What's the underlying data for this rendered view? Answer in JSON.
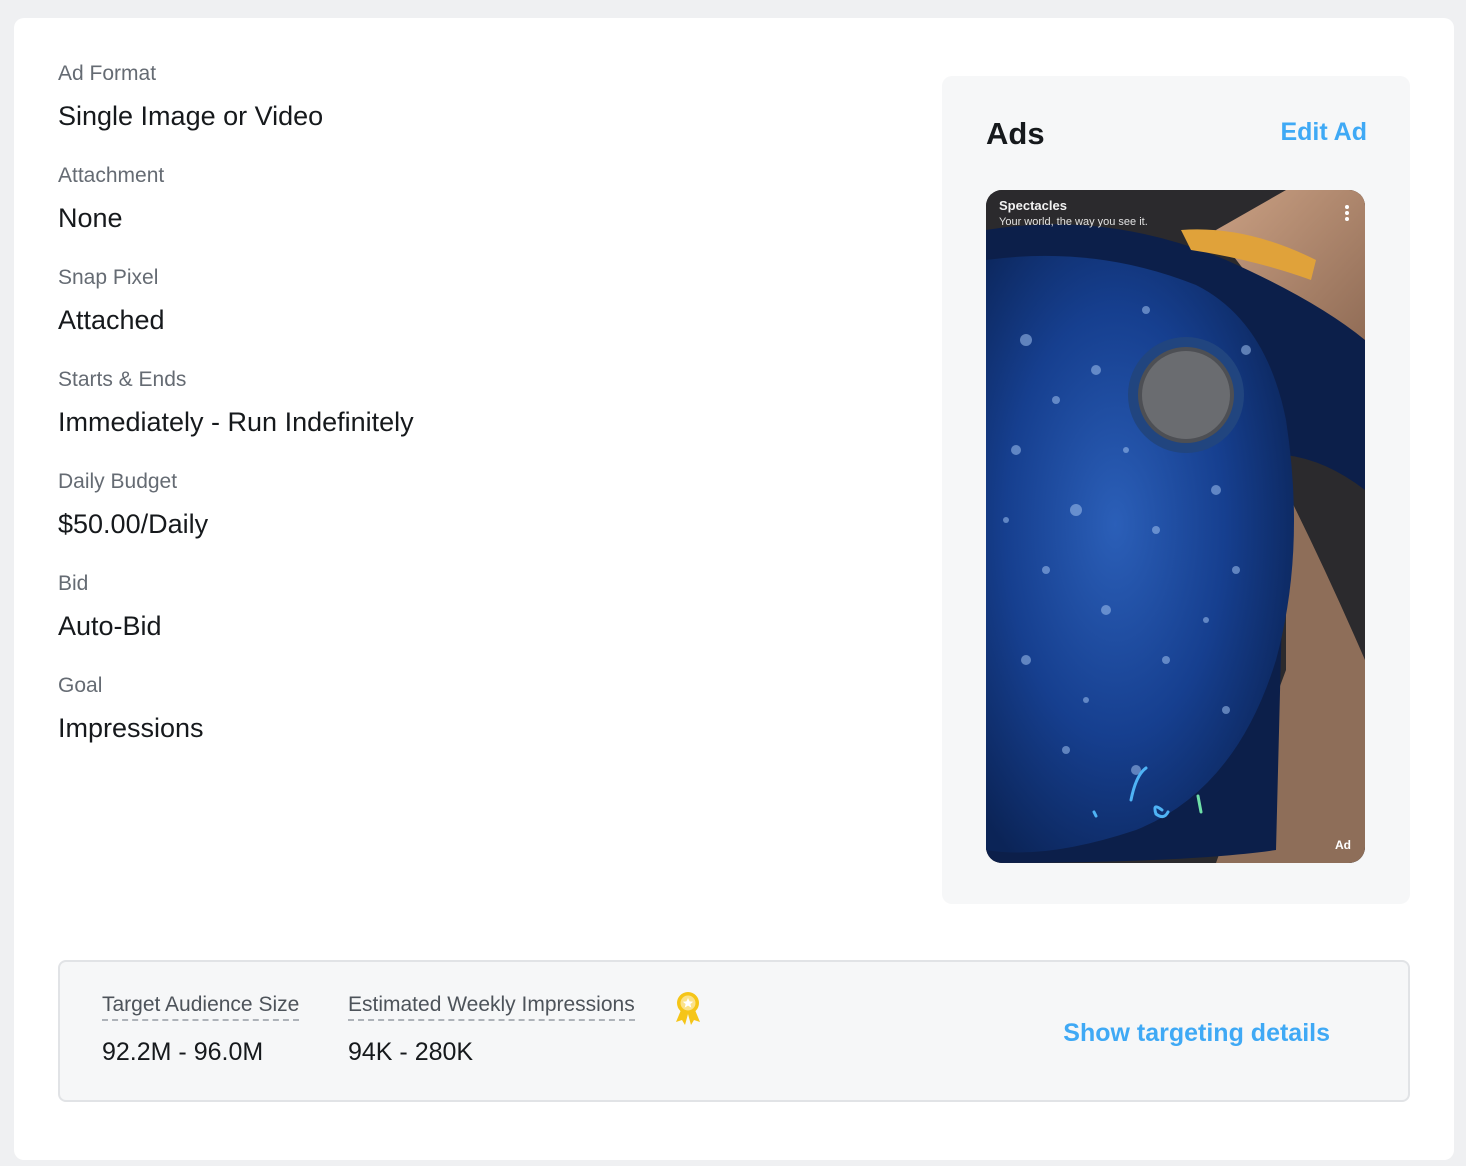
{
  "details": [
    {
      "label": "Ad Format",
      "value": "Single Image or Video"
    },
    {
      "label": "Attachment",
      "value": "None"
    },
    {
      "label": "Snap Pixel",
      "value": "Attached"
    },
    {
      "label": "Starts & Ends",
      "value": "Immediately - Run Indefinitely"
    },
    {
      "label": "Daily Budget",
      "value": "$50.00/Daily"
    },
    {
      "label": "Bid",
      "value": "Auto-Bid"
    },
    {
      "label": "Goal",
      "value": "Impressions"
    }
  ],
  "ads": {
    "title": "Ads",
    "edit_label": "Edit Ad",
    "preview": {
      "brand": "Spectacles",
      "tagline": "Your world, the way you see it.",
      "badge": "Ad",
      "image_subject": "blue sunglasses with water droplets held by fingers"
    }
  },
  "estimates": {
    "audience_label": "Target Audience Size",
    "audience_value": "92.2M - 96.0M",
    "impressions_label": "Estimated Weekly Impressions",
    "impressions_value": "94K - 280K",
    "award_icon": "award-ribbon-icon",
    "show_targeting_label": "Show targeting details"
  },
  "colors": {
    "accent": "#3fa9f5",
    "label": "#656b73",
    "text": "#16191c",
    "panel": "#f6f7f8",
    "award": "#f5c518"
  }
}
